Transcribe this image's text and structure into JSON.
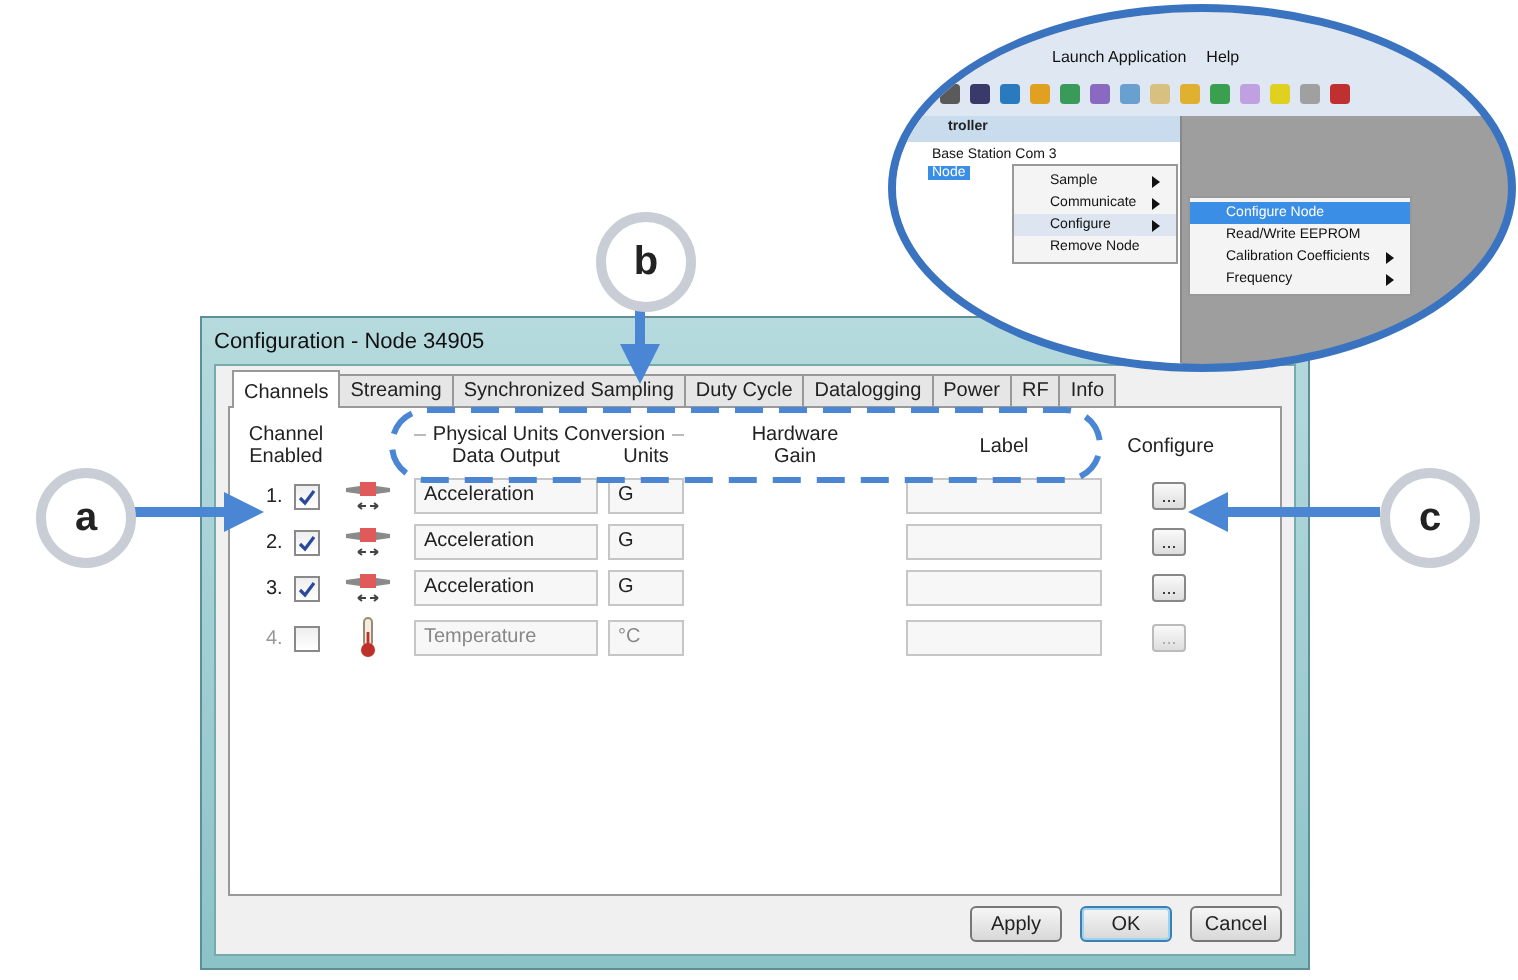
{
  "window": {
    "title": "Configuration - Node 34905"
  },
  "tabs": [
    {
      "label": "Channels",
      "selected": true
    },
    {
      "label": "Streaming",
      "selected": false
    },
    {
      "label": "Synchronized Sampling",
      "selected": false
    },
    {
      "label": "Duty Cycle",
      "selected": false
    },
    {
      "label": "Datalogging",
      "selected": false
    },
    {
      "label": "Power",
      "selected": false
    },
    {
      "label": "RF",
      "selected": false
    },
    {
      "label": "Info",
      "selected": false
    }
  ],
  "headers": {
    "channel_enabled": "Channel Enabled",
    "group": "Physical Units Conversion",
    "data_output": "Data Output",
    "units": "Units",
    "hardware_gain": "Hardware Gain",
    "label": "Label",
    "configure": "Configure"
  },
  "channels": [
    {
      "number": "1.",
      "checked": true,
      "disabled": false,
      "kind": "accelerometer",
      "data_output": "Acceleration",
      "units": "G",
      "configure_button": "..."
    },
    {
      "number": "2.",
      "checked": true,
      "disabled": false,
      "kind": "accelerometer",
      "data_output": "Acceleration",
      "units": "G",
      "configure_button": "..."
    },
    {
      "number": "3.",
      "checked": true,
      "disabled": false,
      "kind": "accelerometer",
      "data_output": "Acceleration",
      "units": "G",
      "configure_button": "..."
    },
    {
      "number": "4.",
      "checked": false,
      "disabled": true,
      "kind": "thermometer",
      "data_output": "Temperature",
      "units": "°C",
      "configure_button": "..."
    }
  ],
  "buttons": [
    {
      "label": "Apply",
      "default": false
    },
    {
      "label": "OK",
      "default": true
    },
    {
      "label": "Cancel",
      "default": false
    }
  ],
  "callouts": [
    {
      "letter": "a"
    },
    {
      "letter": "b"
    },
    {
      "letter": "c"
    }
  ],
  "inset": {
    "menu": [
      "Launch Application",
      "Help"
    ],
    "panel_title": "troller",
    "tree": [
      {
        "label": "Base Station Com 3",
        "selected": false
      },
      {
        "label": "Node",
        "selected": true
      }
    ],
    "context_menu": [
      {
        "label": "Sample",
        "submenu": true,
        "selected": false
      },
      {
        "label": "Communicate",
        "submenu": true,
        "selected": false
      },
      {
        "label": "Configure",
        "submenu": true,
        "selected": true
      },
      {
        "label": "Remove Node",
        "submenu": false,
        "selected": false
      }
    ],
    "submenu": [
      {
        "label": "Configure Node",
        "submenu": false,
        "selected": true
      },
      {
        "label": "Read/Write EEPROM",
        "submenu": false,
        "selected": false
      },
      {
        "label": "Calibration Coefficients",
        "submenu": true,
        "selected": false
      },
      {
        "label": "Frequency",
        "submenu": true,
        "selected": false
      }
    ]
  }
}
